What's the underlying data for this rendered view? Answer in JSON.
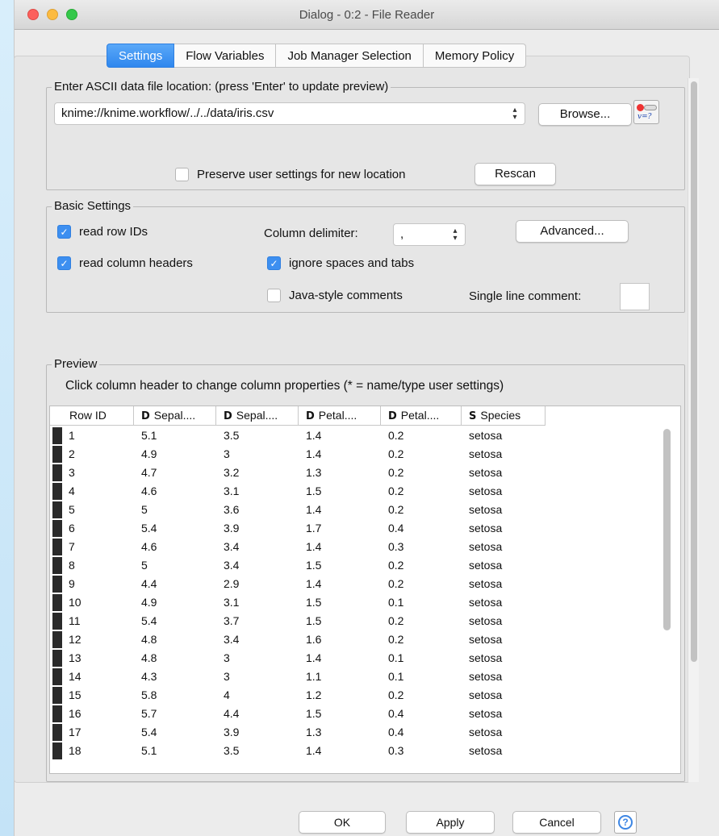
{
  "window": {
    "title": "Dialog - 0:2 - File Reader"
  },
  "tabs": [
    {
      "label": "Settings",
      "active": true
    },
    {
      "label": "Flow Variables",
      "active": false
    },
    {
      "label": "Job Manager Selection",
      "active": false
    },
    {
      "label": "Memory Policy",
      "active": false
    }
  ],
  "file_location": {
    "group_title": "Enter ASCII data file location: (press 'Enter' to update preview)",
    "path_value": "knime://knime.workflow/../../data/iris.csv",
    "browse_label": "Browse...",
    "flow_var_icon": "flow-variable-icon",
    "preserve_label": "Preserve user settings for new location",
    "preserve_checked": false,
    "rescan_label": "Rescan"
  },
  "basic_settings": {
    "group_title": "Basic Settings",
    "read_row_ids": {
      "label": "read row IDs",
      "checked": true
    },
    "read_col_headers": {
      "label": "read column headers",
      "checked": true
    },
    "column_delimiter_label": "Column delimiter:",
    "column_delimiter_value": ",",
    "advanced_label": "Advanced...",
    "ignore_spaces": {
      "label": "ignore spaces and tabs",
      "checked": true
    },
    "java_comments": {
      "label": "Java-style comments",
      "checked": false
    },
    "single_line_comment_label": "Single line comment:",
    "single_line_comment_value": ""
  },
  "preview": {
    "group_title": "Preview",
    "hint": "Click column header to change column properties (* = name/type user settings)",
    "columns": [
      {
        "type": "",
        "label": "Row ID"
      },
      {
        "type": "D",
        "label": "Sepal...."
      },
      {
        "type": "D",
        "label": "Sepal...."
      },
      {
        "type": "D",
        "label": "Petal...."
      },
      {
        "type": "D",
        "label": "Petal...."
      },
      {
        "type": "S",
        "label": "Species"
      }
    ],
    "rows": [
      [
        "1",
        "5.1",
        "3.5",
        "1.4",
        "0.2",
        "setosa"
      ],
      [
        "2",
        "4.9",
        "3",
        "1.4",
        "0.2",
        "setosa"
      ],
      [
        "3",
        "4.7",
        "3.2",
        "1.3",
        "0.2",
        "setosa"
      ],
      [
        "4",
        "4.6",
        "3.1",
        "1.5",
        "0.2",
        "setosa"
      ],
      [
        "5",
        "5",
        "3.6",
        "1.4",
        "0.2",
        "setosa"
      ],
      [
        "6",
        "5.4",
        "3.9",
        "1.7",
        "0.4",
        "setosa"
      ],
      [
        "7",
        "4.6",
        "3.4",
        "1.4",
        "0.3",
        "setosa"
      ],
      [
        "8",
        "5",
        "3.4",
        "1.5",
        "0.2",
        "setosa"
      ],
      [
        "9",
        "4.4",
        "2.9",
        "1.4",
        "0.2",
        "setosa"
      ],
      [
        "10",
        "4.9",
        "3.1",
        "1.5",
        "0.1",
        "setosa"
      ],
      [
        "11",
        "5.4",
        "3.7",
        "1.5",
        "0.2",
        "setosa"
      ],
      [
        "12",
        "4.8",
        "3.4",
        "1.6",
        "0.2",
        "setosa"
      ],
      [
        "13",
        "4.8",
        "3",
        "1.4",
        "0.1",
        "setosa"
      ],
      [
        "14",
        "4.3",
        "3",
        "1.1",
        "0.1",
        "setosa"
      ],
      [
        "15",
        "5.8",
        "4",
        "1.2",
        "0.2",
        "setosa"
      ],
      [
        "16",
        "5.7",
        "4.4",
        "1.5",
        "0.4",
        "setosa"
      ],
      [
        "17",
        "5.4",
        "3.9",
        "1.3",
        "0.4",
        "setosa"
      ],
      [
        "18",
        "5.1",
        "3.5",
        "1.4",
        "0.3",
        "setosa"
      ]
    ]
  },
  "footer": {
    "ok_label": "OK",
    "apply_label": "Apply",
    "cancel_label": "Cancel",
    "help_label": "?"
  },
  "colors": {
    "accent": "#3d8ff0",
    "background": "#ececec"
  }
}
